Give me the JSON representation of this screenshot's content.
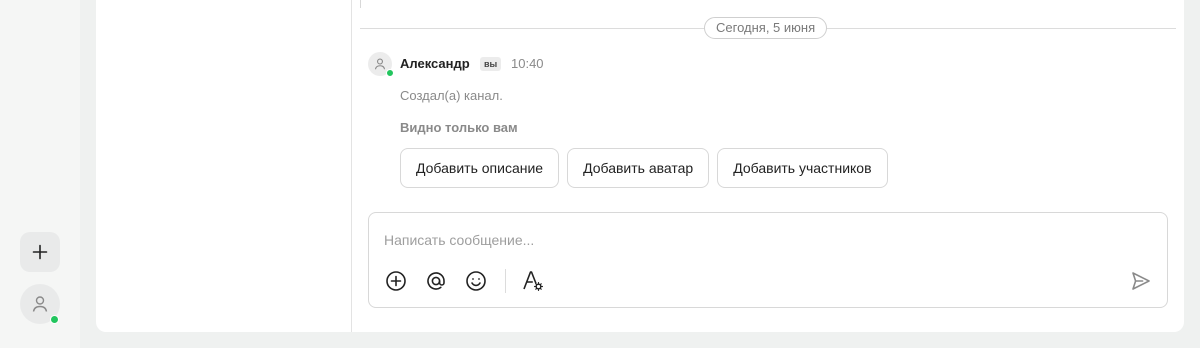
{
  "rail": {
    "add_icon": "plus-icon",
    "profile_icon": "user-icon",
    "online_color": "#22c55e"
  },
  "chat": {
    "date_separator": "Сегодня, 5 июня",
    "message": {
      "author": "Александр",
      "you_badge": "вы",
      "time": "10:40",
      "text": "Создал(а) канал.",
      "visibility_note": "Видно только вам",
      "actions": [
        {
          "label": "Добавить описание"
        },
        {
          "label": "Добавить аватар"
        },
        {
          "label": "Добавить участников"
        }
      ]
    },
    "composer": {
      "placeholder": "Написать сообщение...",
      "tools": [
        "plus-circle-icon",
        "at-icon",
        "smile-icon",
        "text-format-icon"
      ],
      "send_icon": "send-icon"
    }
  }
}
